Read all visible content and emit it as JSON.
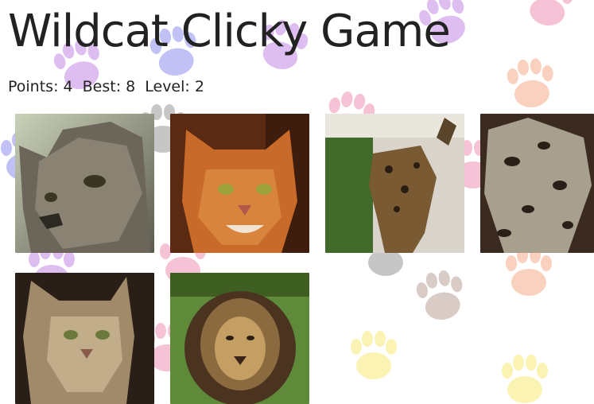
{
  "title": "Wildcat Clicky Game",
  "score": {
    "points_label": "Points:",
    "points": "4",
    "best_label": "Best:",
    "best": "8",
    "level_label": "Level:",
    "level": "2"
  },
  "cards": [
    {
      "name": "wildcat-card-tabby-closeup"
    },
    {
      "name": "wildcat-card-asian-golden-cat"
    },
    {
      "name": "wildcat-card-leopard-cat"
    },
    {
      "name": "wildcat-card-clouded-leopard"
    },
    {
      "name": "wildcat-card-european-wildcat"
    },
    {
      "name": "wildcat-card-lion"
    }
  ],
  "colors": {
    "paw_lilac": "#d9b3ee",
    "paw_blue": "#b7b7f5",
    "paw_pink": "#f4b8cf",
    "paw_peach": "#f9c9b3",
    "paw_gray": "#bdbdbd",
    "paw_taupe": "#d3c2bb",
    "paw_yellow": "#fbf2a6"
  }
}
